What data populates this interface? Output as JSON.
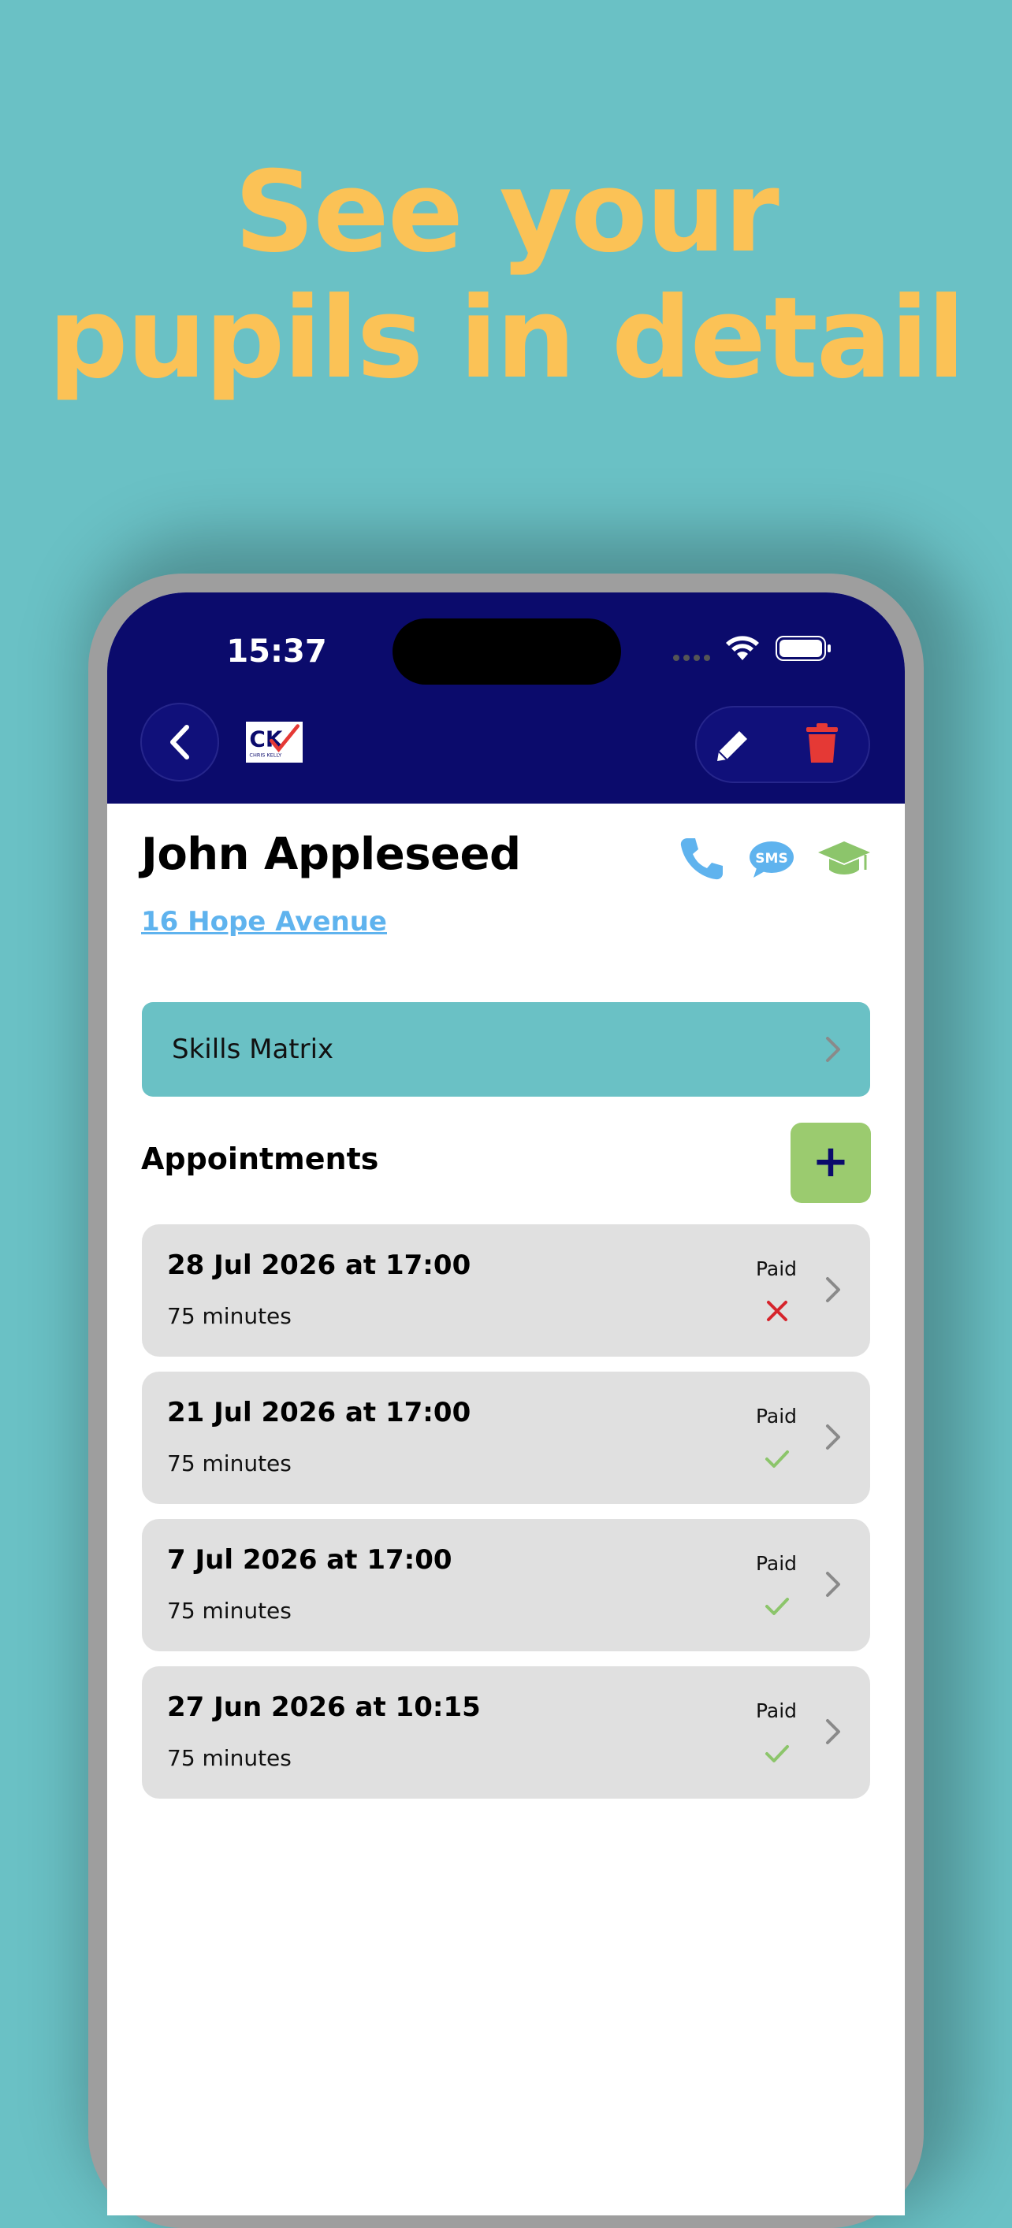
{
  "headline": [
    "See your",
    "pupils in detail"
  ],
  "status_bar": {
    "time": "15:37"
  },
  "header": {
    "logo_text": "CK",
    "logo_subtext": "CHRIS KELLY"
  },
  "pupil": {
    "name": "John Appleseed",
    "address": "16 Hope Avenue"
  },
  "skills_matrix": {
    "label": "Skills Matrix"
  },
  "appointments": {
    "title": "Appointments",
    "add_label": "+",
    "items": [
      {
        "date": "28 Jul 2026 at 17:00",
        "duration": "75 minutes",
        "paid_label": "Paid",
        "paid": false
      },
      {
        "date": "21 Jul 2026 at 17:00",
        "duration": "75 minutes",
        "paid_label": "Paid",
        "paid": true
      },
      {
        "date": "7 Jul 2026 at 17:00",
        "duration": "75 minutes",
        "paid_label": "Paid",
        "paid": true
      },
      {
        "date": "27 Jun 2026 at 10:15",
        "duration": "75 minutes",
        "paid_label": "Paid",
        "paid": true
      }
    ]
  },
  "colors": {
    "background": "#6ac1c5",
    "headline": "#fbc256",
    "navbar": "#0b0b6c",
    "link": "#5fb3ee",
    "paid_yes": "#8cc56b",
    "paid_no": "#d6242c",
    "delete": "#e53935",
    "add_button": "#9bcb6f"
  }
}
